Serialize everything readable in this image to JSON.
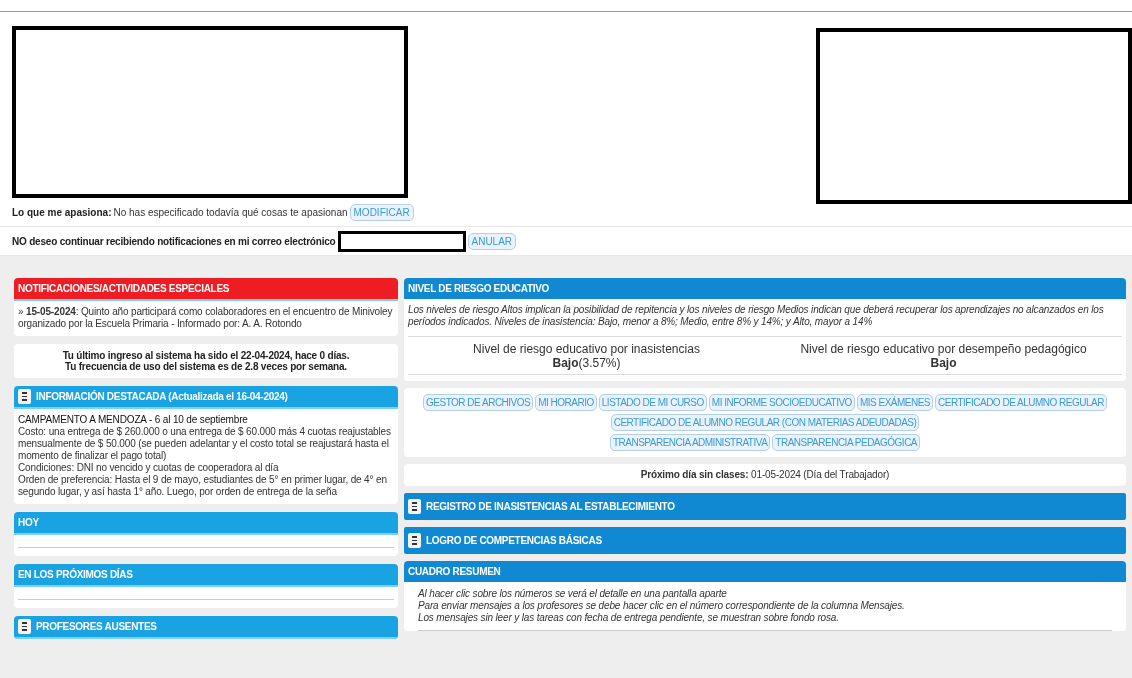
{
  "passion": {
    "label": "Lo que me apasiona:",
    "text": "No has especificado todavía qué cosas te apasionan",
    "button": "MODIFICAR"
  },
  "unsubscribe": {
    "text": "NO deseo continuar recibiendo notificaciones en mi correo electrónico",
    "button": "ANULAR"
  },
  "left": [
    {
      "kind": "list",
      "title": "NOTIFICACIONES/ACTIVIDADES ESPECIALES",
      "color": "#ee1d23",
      "menu": false,
      "items": [
        {
          "text": "» **15-05-2024**: Quinto año participará como colaboradores en el encuentro de Minivoley organizado por la Escuela Primaria - Informado por: A. A. Rotondo"
        }
      ]
    },
    {
      "kind": "info",
      "lines": [
        "Tu último ingreso al sistema ha sido el 22-04-2024, hace 0 días.",
        "Tu frecuencia de uso del sistema es de 2.8 veces por semana."
      ]
    },
    {
      "kind": "text",
      "title": "INFORMACIÓN DESTACADA (Actualizada el 16-04-2024)",
      "color": "#1aa3e3",
      "menu": true,
      "lines": [
        "CAMPAMENTO A MENDOZA - 6 al 10 de septiembre",
        "Costo: una entrega de $ 260.000 o una entrega de $ 60.000 más 4 cuotas reajustables mensualmente de $ 50.000 (se pueden adelantar y el costo total se reajustará hasta el momento de finalizar el pago total)",
        "Condiciones: DNI no vencido y cuotas de cooperadora al día",
        "Orden de preferencia: Hasta el 9 de mayo, estudiantes de 5° en primer lugar, de 4° en segundo lugar, y así hasta 1° año. Luego, por orden de entrega de la seña"
      ]
    },
    {
      "kind": "empty",
      "title": "HOY",
      "color": "#1aa3e3",
      "menu": false
    },
    {
      "kind": "empty",
      "title": "EN LOS PRÓXIMOS DÍAS",
      "color": "#1aa3e3",
      "menu": false
    },
    {
      "kind": "header",
      "title": "PROFESORES AUSENTES",
      "color": "#1aa3e3",
      "menu": true
    }
  ],
  "risk": {
    "title": "NIVEL DE RIESGO EDUCATIVO",
    "note": "Los niveles de riesgo Altos implican la posibilidad de repitencia y los niveles de riesgo Medios indican que deberá recuperar los aprendizajes no alcanzados en los períodos indicados. Niveles de inasistencia: Bajo, menor a 8%; Medio, entre 8% y 14%; y Alto, mayor a 14%",
    "metrics": [
      {
        "label": "Nivel de riesgo educativo por inasistencias",
        "value": "Bajo",
        "detail": "(3.57%)"
      },
      {
        "label": "Nivel de riesgo educativo por desempeño pedagógico",
        "value": "Bajo"
      }
    ]
  },
  "links": [
    [
      "GESTOR DE ARCHIVOS",
      "MI HORARIO",
      "LISTADO DE MI CURSO",
      "MI INFORME SOCIOEDUCATIVO",
      "MIS EXÁMENES",
      "CERTIFICADO DE ALUMNO REGULAR"
    ],
    [
      "CERTIFICADO DE ALUMNO REGULAR (CON MATERIAS ADEUDADAS)"
    ],
    [
      "TRANSPARENCIA ADMINISTRATIVA",
      "TRANSPARENCIA PEDAGÓGICA"
    ]
  ],
  "holiday": {
    "label": "Próximo día sin clases:",
    "value": "01-05-2024 (Día del Trabajador)"
  },
  "sections": [
    {
      "title": "REGISTRO DE INASISTENCIAS AL ESTABLECIMIENTO",
      "menu": true
    },
    {
      "title": "LOGRO DE COMPETENCIAS BÁSICAS",
      "menu": true
    }
  ],
  "summary": {
    "title": "CUADRO RESUMEN",
    "lines": [
      "Al hacer clic sobre los números se verá el detalle en una pantalla aparte",
      "Para enviar mensajes a los profesores se debe hacer clic en el número correspondiente de la columna Mensajes.",
      "Los mensajes sin leer y las tareas con fecha de entrega pendiente, se muestran sobre fondo rosa."
    ]
  }
}
